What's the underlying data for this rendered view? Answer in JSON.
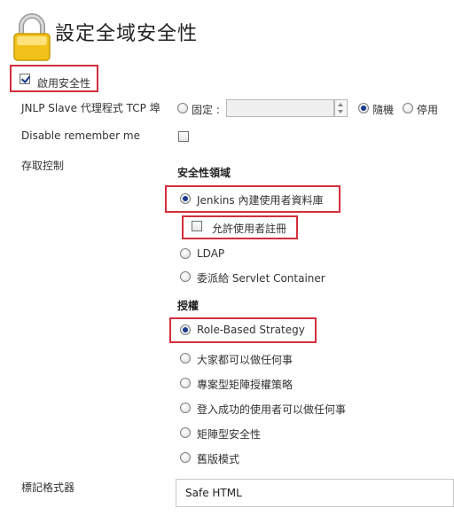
{
  "page": {
    "title": "設定全域安全性"
  },
  "enable_security": {
    "label": "啟用安全性",
    "checked": true
  },
  "jnlp": {
    "label": "JNLP Slave 代理程式 TCP 埠",
    "fixed_label": "固定 :",
    "port_value": "",
    "random_label": "隨機",
    "disable_label": "停用",
    "selected": "隨機"
  },
  "remember_me": {
    "label": "Disable remember me",
    "checked": false
  },
  "access_control": {
    "label": "存取控制",
    "security_realm": {
      "heading": "安全性領域",
      "options": [
        {
          "label": "Jenkins 內建使用者資料庫",
          "selected": true
        },
        {
          "label": "LDAP",
          "selected": false
        },
        {
          "label": "委派給 Servlet Container",
          "selected": false
        }
      ],
      "allow_signup": {
        "label": "允許使用者註冊",
        "checked": false
      }
    },
    "authorization": {
      "heading": "授權",
      "options": [
        {
          "label": "Role-Based Strategy",
          "selected": true
        },
        {
          "label": "大家都可以做任何事",
          "selected": false
        },
        {
          "label": "專案型矩陣授權策略",
          "selected": false
        },
        {
          "label": "登入成功的使用者可以做任何事",
          "selected": false
        },
        {
          "label": "矩陣型安全性",
          "selected": false
        },
        {
          "label": "舊版模式",
          "selected": false
        }
      ]
    }
  },
  "markup_formatter": {
    "label": "標記格式器",
    "value": "Safe HTML"
  },
  "colors": {
    "highlight": "#d32f3a",
    "radio_dot": "#1a3a8c",
    "lock_gold": "#f2c21a"
  }
}
